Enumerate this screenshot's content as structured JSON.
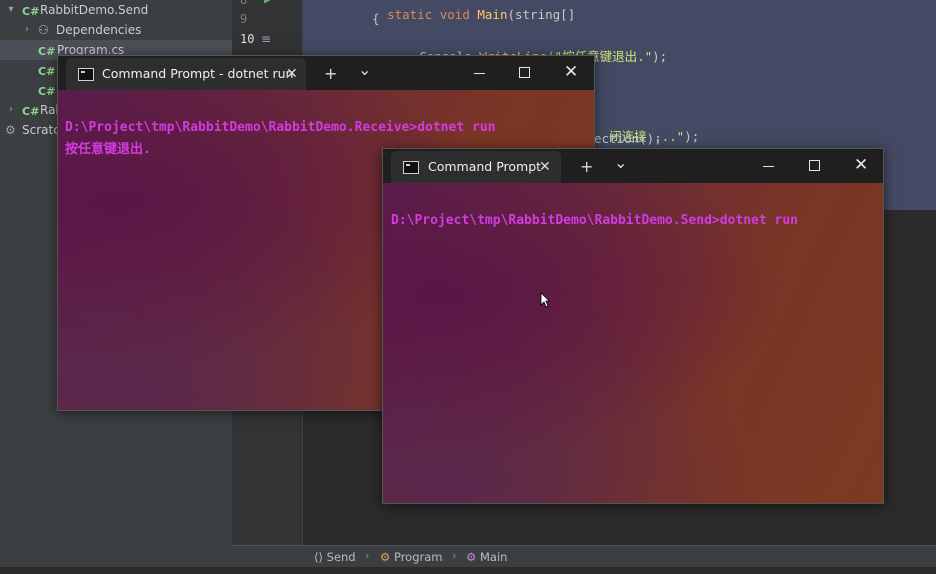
{
  "ide": {
    "tree": [
      {
        "label": "RabbitDemo.Send",
        "badge": "C#"
      },
      {
        "label": "Dependencies"
      },
      {
        "label": "Program.cs",
        "badge": "C#"
      },
      {
        "badge": "C#"
      },
      {
        "badge": "C#"
      },
      {
        "label": "Rab",
        "badge": "C#"
      },
      {
        "label": "Scratch"
      }
    ],
    "line_numbers": [
      "8",
      "9",
      "10"
    ],
    "code": {
      "line8": {
        "kw": "static void ",
        "fn": "Main",
        "rest": "(string[] "
      },
      "line9": "{",
      "line10": {
        "cls": "Console",
        "dot": ".",
        "fn": "WriteLine",
        "open": "(",
        "str": "\"按任意键退出.\"",
        "close": ");"
      },
      "line_conn": {
        "str": "闭连接 ...\"",
        "close": ");"
      },
      "line_dispose": "ection();"
    },
    "breadcrumb": [
      {
        "label": "Send",
        "icon": "namespace-icon"
      },
      {
        "label": "Program",
        "icon": "class-icon"
      },
      {
        "label": "Main",
        "icon": "method-icon"
      }
    ]
  },
  "terminals": {
    "receive": {
      "tab_title": "Command Prompt - dotnet  run",
      "lines": [
        "D:\\Project\\tmp\\RabbitDemo\\RabbitDemo.Receive>dotnet run",
        "按任意键退出."
      ]
    },
    "send": {
      "tab_title": "Command Prompt",
      "lines": [
        "D:\\Project\\tmp\\RabbitDemo\\RabbitDemo.Send>dotnet run"
      ]
    },
    "new_tab_symbol": "+",
    "dropdown_symbol": "⌄",
    "close_symbol": "✕"
  },
  "colors": {
    "terminal_text": "#d23be0",
    "ide_background": "#2b2d30"
  }
}
